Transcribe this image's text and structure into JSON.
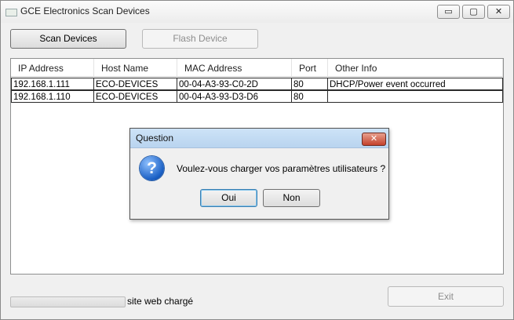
{
  "window": {
    "title": "GCE Electronics Scan Devices",
    "caption": {
      "minimize": "▭",
      "maximize": "▢",
      "close": "✕"
    }
  },
  "toolbar": {
    "scan_label": "Scan Devices",
    "flash_label": "Flash Device"
  },
  "table": {
    "columns": [
      "IP Address",
      "Host Name",
      "MAC Address",
      "Port",
      "Other Info"
    ],
    "rows": [
      [
        "192.168.1.111",
        "ECO-DEVICES",
        "00-04-A3-93-C0-2D",
        "80",
        "DHCP/Power event occurred"
      ],
      [
        "192.168.1.110",
        "ECO-DEVICES",
        "00-04-A3-93-D3-D6",
        "80",
        ""
      ]
    ]
  },
  "status": {
    "text": "site web chargé",
    "progress": 0
  },
  "footer": {
    "exit_label": "Exit"
  },
  "dialog": {
    "title": "Question",
    "close": "✕",
    "icon": "question-icon",
    "icon_glyph": "?",
    "message": "Voulez-vous charger vos paramètres utilisateurs ?",
    "yes_label": "Oui",
    "no_label": "Non"
  }
}
